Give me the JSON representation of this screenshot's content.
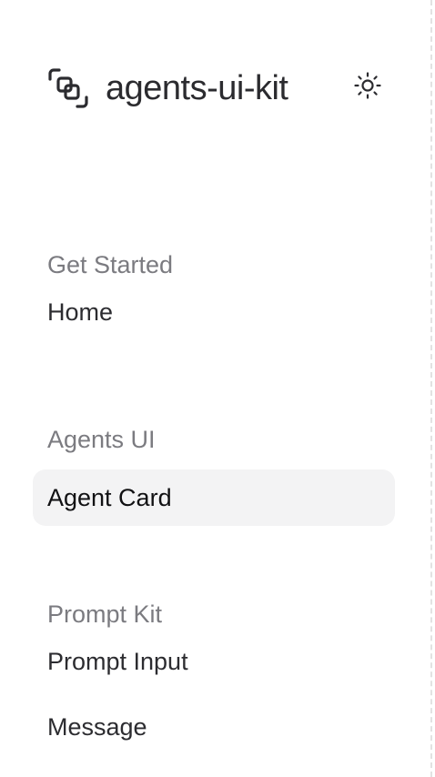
{
  "header": {
    "title": "agents-ui-kit",
    "logo_icon": "focus-squares-icon",
    "theme_toggle_icon": "sun-icon"
  },
  "sections": [
    {
      "label": "Get Started",
      "items": [
        {
          "label": "Home",
          "active": false
        }
      ]
    },
    {
      "label": "Agents UI",
      "items": [
        {
          "label": "Agent Card",
          "active": true
        }
      ]
    },
    {
      "label": "Prompt Kit",
      "items": [
        {
          "label": "Prompt Input",
          "active": false
        },
        {
          "label": "Message",
          "active": false
        }
      ]
    }
  ],
  "colors": {
    "active_background": "#f3f3f4",
    "section_label": "#7b7b80",
    "item_text": "#2c2c30"
  }
}
